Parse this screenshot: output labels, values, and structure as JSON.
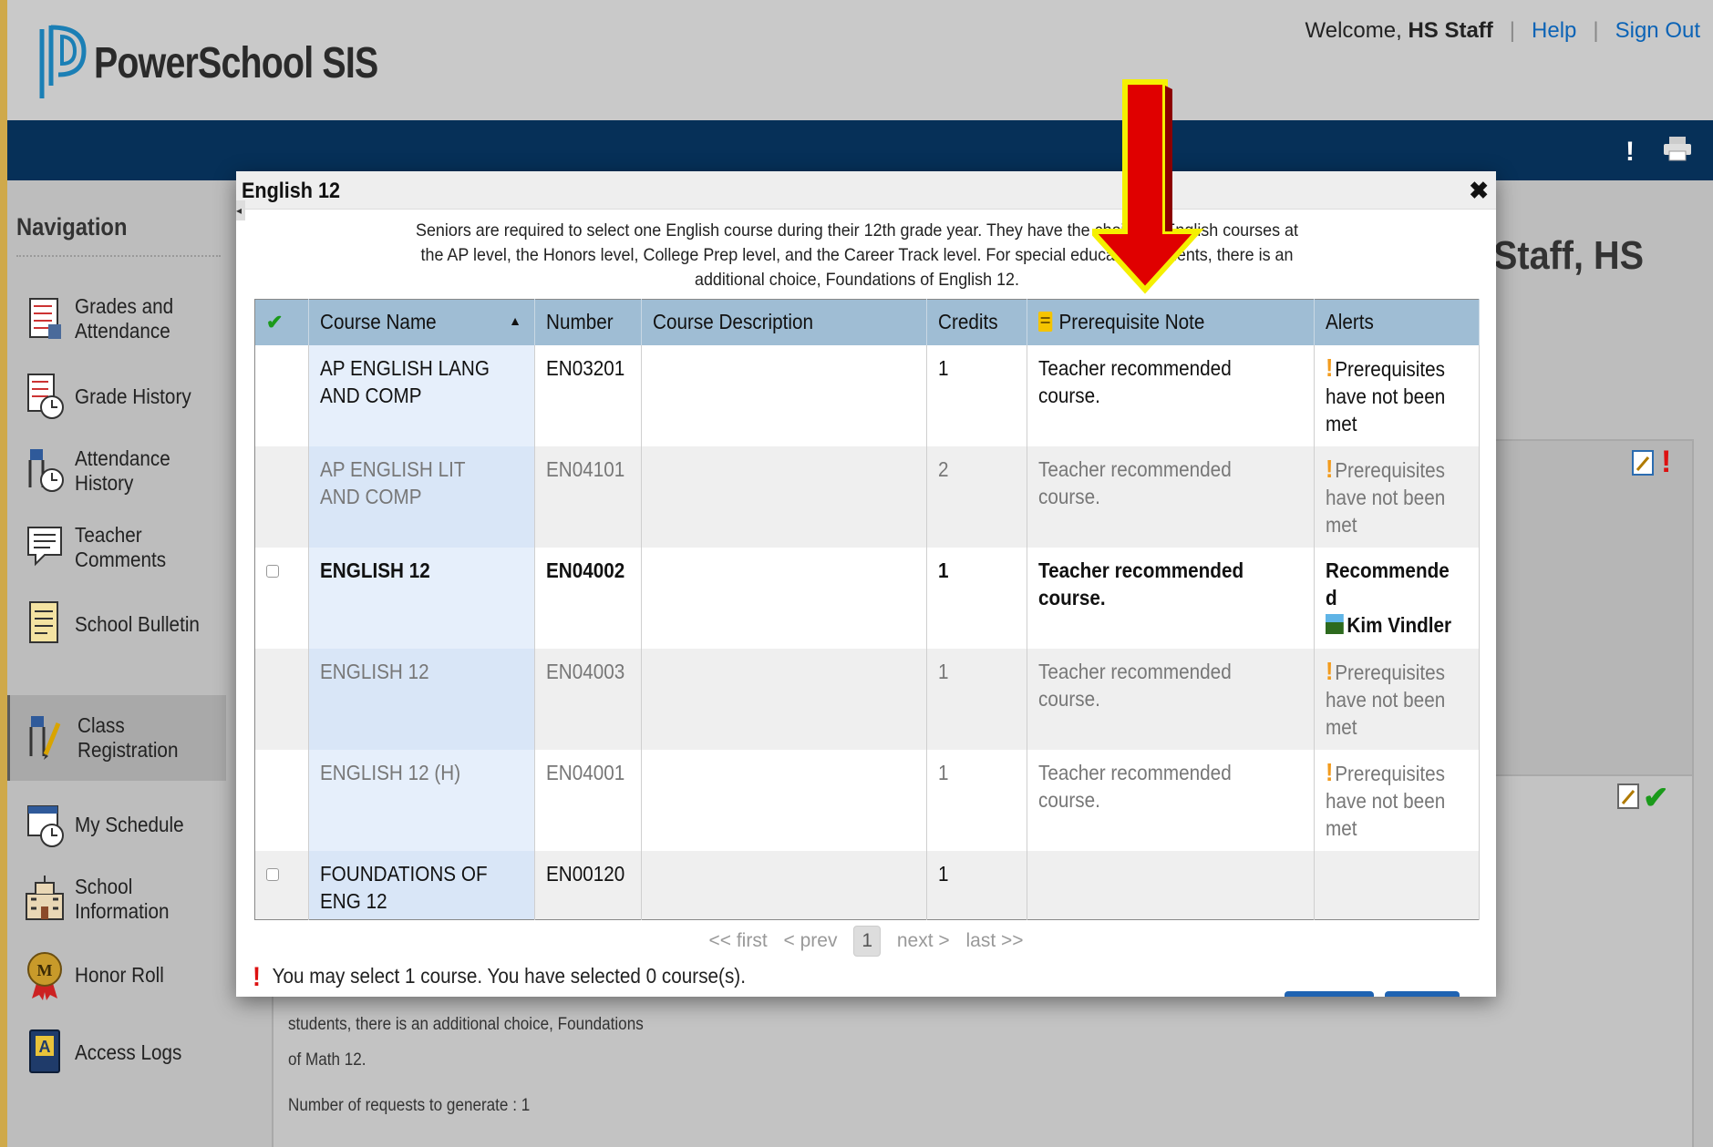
{
  "header": {
    "app_title": "PowerSchool SIS",
    "welcome_prefix": "Welcome,",
    "user_name": "HS Staff",
    "help": "Help",
    "sign_out": "Sign Out"
  },
  "sidebar": {
    "title": "Navigation",
    "items": [
      {
        "label": "Grades and Attendance",
        "icon": "gradebook-icon"
      },
      {
        "label": "Grade History",
        "icon": "grade-history-icon"
      },
      {
        "label": "Attendance History",
        "icon": "attendance-history-icon"
      },
      {
        "label": "Teacher Comments",
        "icon": "comments-icon"
      },
      {
        "label": "School Bulletin",
        "icon": "bulletin-icon"
      },
      {
        "label": "Class Registration",
        "icon": "class-registration-icon",
        "active": true
      },
      {
        "label": "My Schedule",
        "icon": "schedule-icon"
      },
      {
        "label": "School Information",
        "icon": "school-icon"
      },
      {
        "label": "Honor Roll",
        "icon": "honor-roll-medal-icon"
      },
      {
        "label": "Access Logs",
        "icon": "access-logs-icon"
      }
    ]
  },
  "background": {
    "page_title": "Staff, HS",
    "text_1": "students, there is an additional choice, Foundations",
    "text_2": "of Math 12.",
    "text_3": "Number of requests to generate : 1"
  },
  "modal": {
    "title": "English 12",
    "close_icon": "close-icon",
    "description": "Seniors are required to select one English course during their 12th grade year. They have the choice of English courses at the AP level, the Honors level, College Prep level, and the Career Track level. For special education students, there is an additional choice, Foundations of English 12.",
    "columns": {
      "course_name": "Course Name",
      "number": "Number",
      "course_description": "Course Description",
      "credits": "Credits",
      "prerequisite_note": "Prerequisite Note",
      "alerts": "Alerts"
    },
    "rows": [
      {
        "name": "AP ENGLISH LANG AND COMP",
        "number": "EN03201",
        "description": "",
        "credits": "1",
        "note": "Teacher recommended course.",
        "alert": "Prerequisites have not been met"
      },
      {
        "name": "AP ENGLISH LIT AND COMP",
        "number": "EN04101",
        "description": "",
        "credits": "2",
        "note": "Teacher recommended course.",
        "alert": "Prerequisites have not been met"
      },
      {
        "name": "ENGLISH 12",
        "number": "EN04002",
        "description": "",
        "credits": "1",
        "note": "Teacher recommended course.",
        "alert": "Recommended",
        "recommender": "Kim Vindler"
      },
      {
        "name": "ENGLISH 12",
        "number": "EN04003",
        "description": "",
        "credits": "1",
        "note": "Teacher recommended course.",
        "alert": "Prerequisites have not been met"
      },
      {
        "name": "ENGLISH 12 (H)",
        "number": "EN04001",
        "description": "",
        "credits": "1",
        "note": "Teacher recommended course.",
        "alert": "Prerequisites have not been met"
      },
      {
        "name": "FOUNDATIONS OF ENG 12",
        "number": "EN00120",
        "description": "",
        "credits": "1",
        "note": "",
        "alert": ""
      }
    ],
    "pager": {
      "first": "<< first",
      "prev": "< prev",
      "current": "1",
      "next": "next >",
      "last": "last >>"
    },
    "footer_message": "You may select 1 course.  You have selected 0 course(s)."
  },
  "colors": {
    "header_blue": "#063058",
    "table_header": "#9fbdd4",
    "annotation_arrow": "#e00000",
    "annotation_outline": "#f5f000"
  }
}
